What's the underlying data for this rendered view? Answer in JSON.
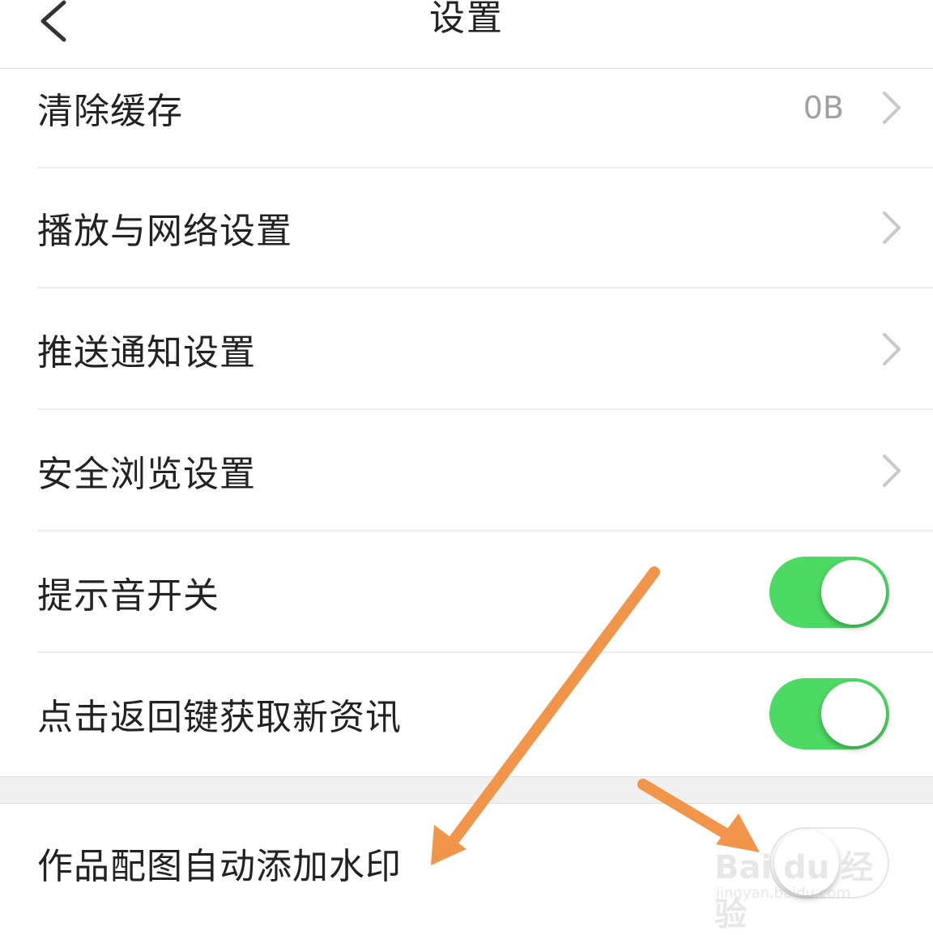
{
  "header": {
    "title": "设置",
    "back_icon": "chevron-left-icon"
  },
  "rows": [
    {
      "label": "清除缓存",
      "value": "0B",
      "control": "chevron"
    },
    {
      "label": "播放与网络设置",
      "control": "chevron"
    },
    {
      "label": "推送通知设置",
      "control": "chevron"
    },
    {
      "label": "安全浏览设置",
      "control": "chevron"
    },
    {
      "label": "提示音开关",
      "control": "toggle",
      "state": "on"
    },
    {
      "label": "点击返回键获取新资讯",
      "control": "toggle",
      "state": "on"
    },
    {
      "label": "作品配图自动添加水印",
      "control": "toggle",
      "state": "off"
    }
  ],
  "colors": {
    "toggle_on": "#4cd964",
    "toggle_off_border": "#e5e5e5",
    "annotation_arrow": "#f0954a",
    "chevron": "#c7c7cc",
    "value_text": "#a0a0a0"
  },
  "watermark": {
    "text": "Bai du 经验",
    "sub": "jingyan.baidu.com"
  }
}
